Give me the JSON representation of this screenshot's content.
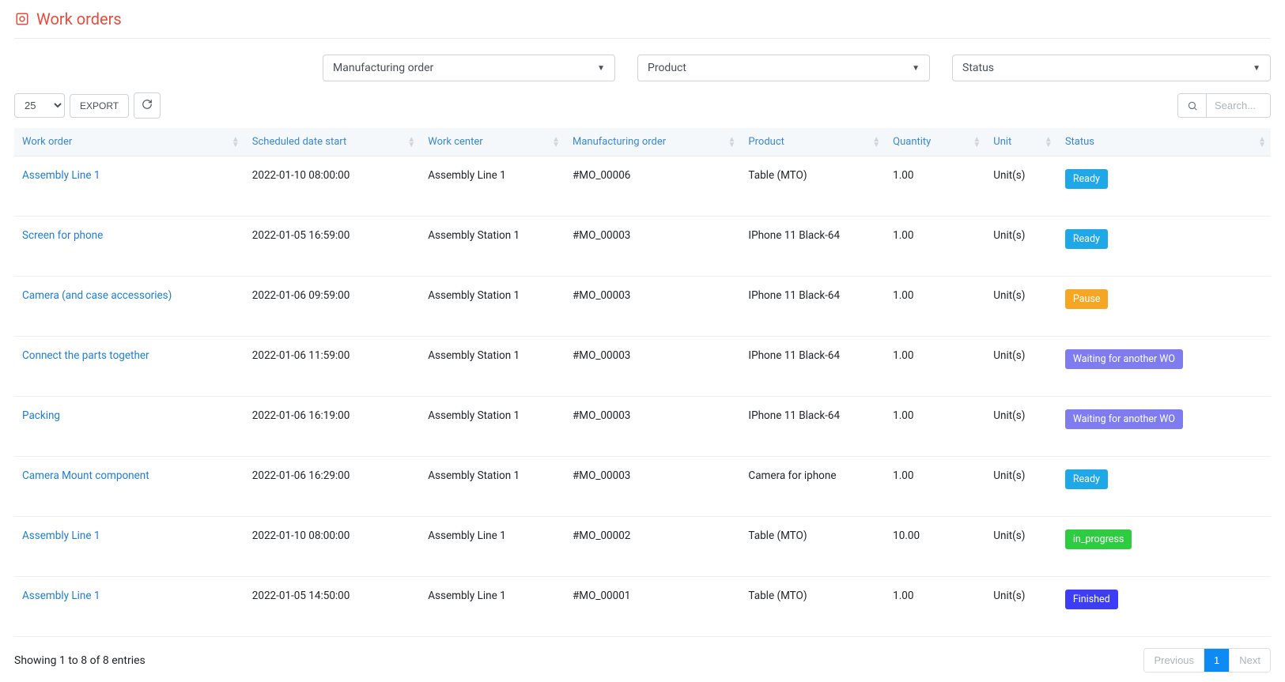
{
  "header": {
    "title": "Work orders"
  },
  "filters": {
    "manufacturing_order": {
      "label": "Manufacturing order"
    },
    "product": {
      "label": "Product"
    },
    "status": {
      "label": "Status"
    }
  },
  "toolbar": {
    "page_size": "25",
    "export_label": "EXPORT",
    "search_placeholder": "Search..."
  },
  "table": {
    "columns": {
      "work_order": "Work order",
      "scheduled_date_start": "Scheduled date start",
      "work_center": "Work center",
      "manufacturing_order": "Manufacturing order",
      "product": "Product",
      "quantity": "Quantity",
      "unit": "Unit",
      "status": "Status"
    },
    "rows": [
      {
        "work_order": "Assembly Line 1",
        "scheduled_date_start": "2022-01-10 08:00:00",
        "work_center": "Assembly Line 1",
        "manufacturing_order": "#MO_00006",
        "product": "Table (MTO)",
        "quantity": "1.00",
        "unit": "Unit(s)",
        "status": {
          "type": "ready",
          "label": "Ready"
        }
      },
      {
        "work_order": "Screen for phone",
        "scheduled_date_start": "2022-01-05 16:59:00",
        "work_center": "Assembly Station 1",
        "manufacturing_order": "#MO_00003",
        "product": "IPhone 11 Black-64",
        "quantity": "1.00",
        "unit": "Unit(s)",
        "status": {
          "type": "ready",
          "label": "Ready"
        }
      },
      {
        "work_order": "Camera (and case accessories)",
        "scheduled_date_start": "2022-01-06 09:59:00",
        "work_center": "Assembly Station 1",
        "manufacturing_order": "#MO_00003",
        "product": "IPhone 11 Black-64",
        "quantity": "1.00",
        "unit": "Unit(s)",
        "status": {
          "type": "pause",
          "label": "Pause"
        }
      },
      {
        "work_order": "Connect the parts together",
        "scheduled_date_start": "2022-01-06 11:59:00",
        "work_center": "Assembly Station 1",
        "manufacturing_order": "#MO_00003",
        "product": "IPhone 11 Black-64",
        "quantity": "1.00",
        "unit": "Unit(s)",
        "status": {
          "type": "waiting",
          "label": "Waiting for another WO"
        }
      },
      {
        "work_order": "Packing",
        "scheduled_date_start": "2022-01-06 16:19:00",
        "work_center": "Assembly Station 1",
        "manufacturing_order": "#MO_00003",
        "product": "IPhone 11 Black-64",
        "quantity": "1.00",
        "unit": "Unit(s)",
        "status": {
          "type": "waiting",
          "label": "Waiting for another WO"
        }
      },
      {
        "work_order": "Camera Mount component",
        "scheduled_date_start": "2022-01-06 16:29:00",
        "work_center": "Assembly Station 1",
        "manufacturing_order": "#MO_00003",
        "product": "Camera for iphone",
        "quantity": "1.00",
        "unit": "Unit(s)",
        "status": {
          "type": "ready",
          "label": "Ready"
        }
      },
      {
        "work_order": "Assembly Line 1",
        "scheduled_date_start": "2022-01-10 08:00:00",
        "work_center": "Assembly Line 1",
        "manufacturing_order": "#MO_00002",
        "product": "Table (MTO)",
        "quantity": "10.00",
        "unit": "Unit(s)",
        "status": {
          "type": "in_progress",
          "label": "in_progress"
        }
      },
      {
        "work_order": "Assembly Line 1",
        "scheduled_date_start": "2022-01-05 14:50:00",
        "work_center": "Assembly Line 1",
        "manufacturing_order": "#MO_00001",
        "product": "Table (MTO)",
        "quantity": "1.00",
        "unit": "Unit(s)",
        "status": {
          "type": "finished",
          "label": "Finished"
        }
      }
    ]
  },
  "footer": {
    "entries_info": "Showing 1 to 8 of 8 entries",
    "pagination": {
      "previous": "Previous",
      "pages": [
        "1"
      ],
      "next": "Next",
      "active": "1"
    }
  }
}
